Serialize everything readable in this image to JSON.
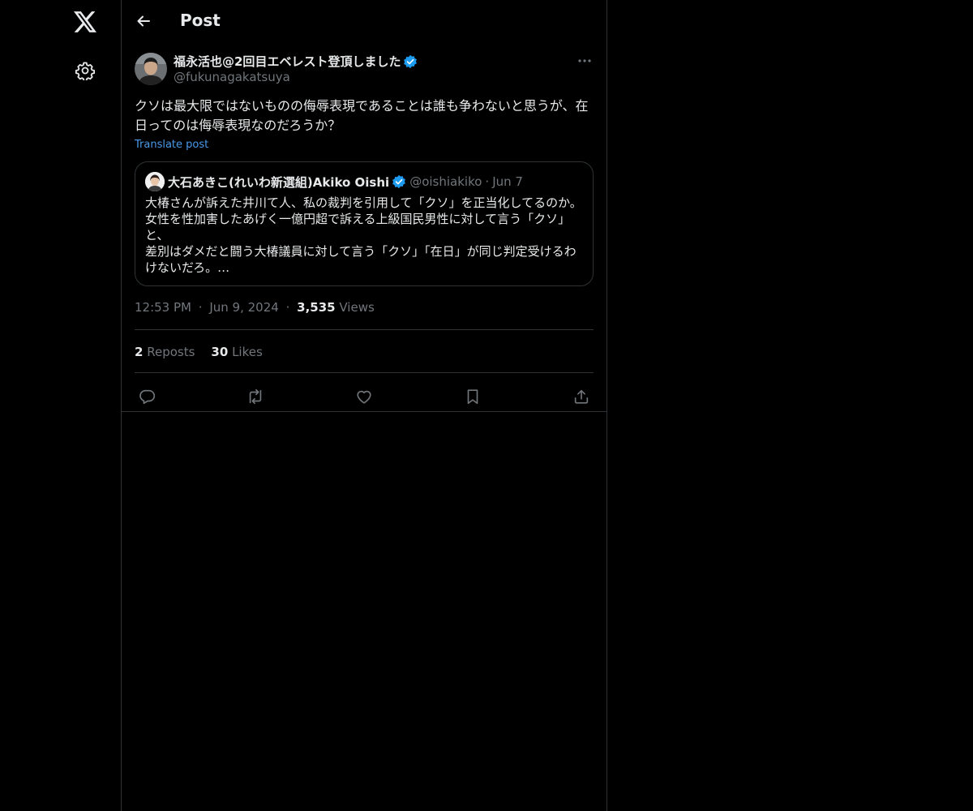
{
  "header": {
    "title": "Post"
  },
  "post": {
    "author_name": "福永活也@2回目エベレスト登頂しました",
    "author_handle": "@fukunagakatsuya",
    "text": "クソは最大限ではないものの侮辱表現であることは誰も争わないと思うが、在日ってのは侮辱表現なのだろうか？",
    "translate_label": "Translate post",
    "time": "12:53 PM",
    "date": "Jun 9, 2024",
    "views_count": "3,535",
    "views_label": "Views",
    "reposts_count": "2",
    "reposts_label": "Reposts",
    "likes_count": "30",
    "likes_label": "Likes",
    "separator": "·"
  },
  "quote": {
    "author_name": "大石あきこ(れいわ新選組)Akiko Oishi",
    "author_handle": "@oishiakiko",
    "date": "Jun 7",
    "text": "大椿さんが訴えた井川て人、私の裁判を引用して「クソ」を正当化してるのか。\n女性を性加害したあげく一億円超で訴える上級国民男性に対して言う「クソ」と、\n差別はダメだと闘う大椿議員に対して言う「クソ」「在日」が同じ判定受けるわけないだろ。…"
  },
  "icons": {
    "logo": "x-logo-icon",
    "settings": "gear-icon",
    "back": "arrow-left-icon",
    "more": "more-dots-icon",
    "verified": "verified-badge-icon",
    "reply": "reply-icon",
    "repost": "repost-icon",
    "like": "heart-icon",
    "bookmark": "bookmark-icon",
    "share": "share-icon"
  },
  "colors": {
    "background": "#000000",
    "text": "#e7e9ea",
    "muted": "#71767b",
    "border": "#2f3336",
    "link": "#4a99e9",
    "verified": "#1d9bf0"
  }
}
